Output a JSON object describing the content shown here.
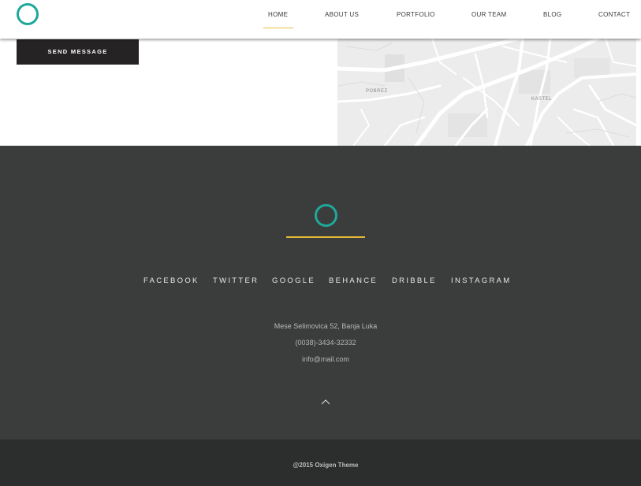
{
  "nav": {
    "items": [
      {
        "label": "HOME",
        "active": true
      },
      {
        "label": "ABOUT US"
      },
      {
        "label": "PORTFOLIO"
      },
      {
        "label": "OUR TEAM"
      },
      {
        "label": "BLOG"
      },
      {
        "label": "CONTACT"
      }
    ]
  },
  "form": {
    "send_label": "SEND MESSAGE"
  },
  "map": {
    "labels": [
      "POBREZ",
      "KASTEL"
    ]
  },
  "footer": {
    "social": [
      "FACEBOOK",
      "TWITTER",
      "GOOGLE",
      "BEHANCE",
      "DRIBBLE",
      "INSTAGRAM"
    ],
    "address": "Mese Selimovica 52, Banja Luka",
    "phone": "(0038)-3434-32332",
    "email": "info@mail.com"
  },
  "copyright": "@2015 Oxigen Theme",
  "colors": {
    "accent": "#1fa89a",
    "highlight": "#e6b93a",
    "footer_bg": "#3b3c3c",
    "bottom_bg": "#2c2d2d"
  },
  "icons": {
    "logo": "ring-logo-icon",
    "scroll_top": "chevron-up-icon"
  }
}
